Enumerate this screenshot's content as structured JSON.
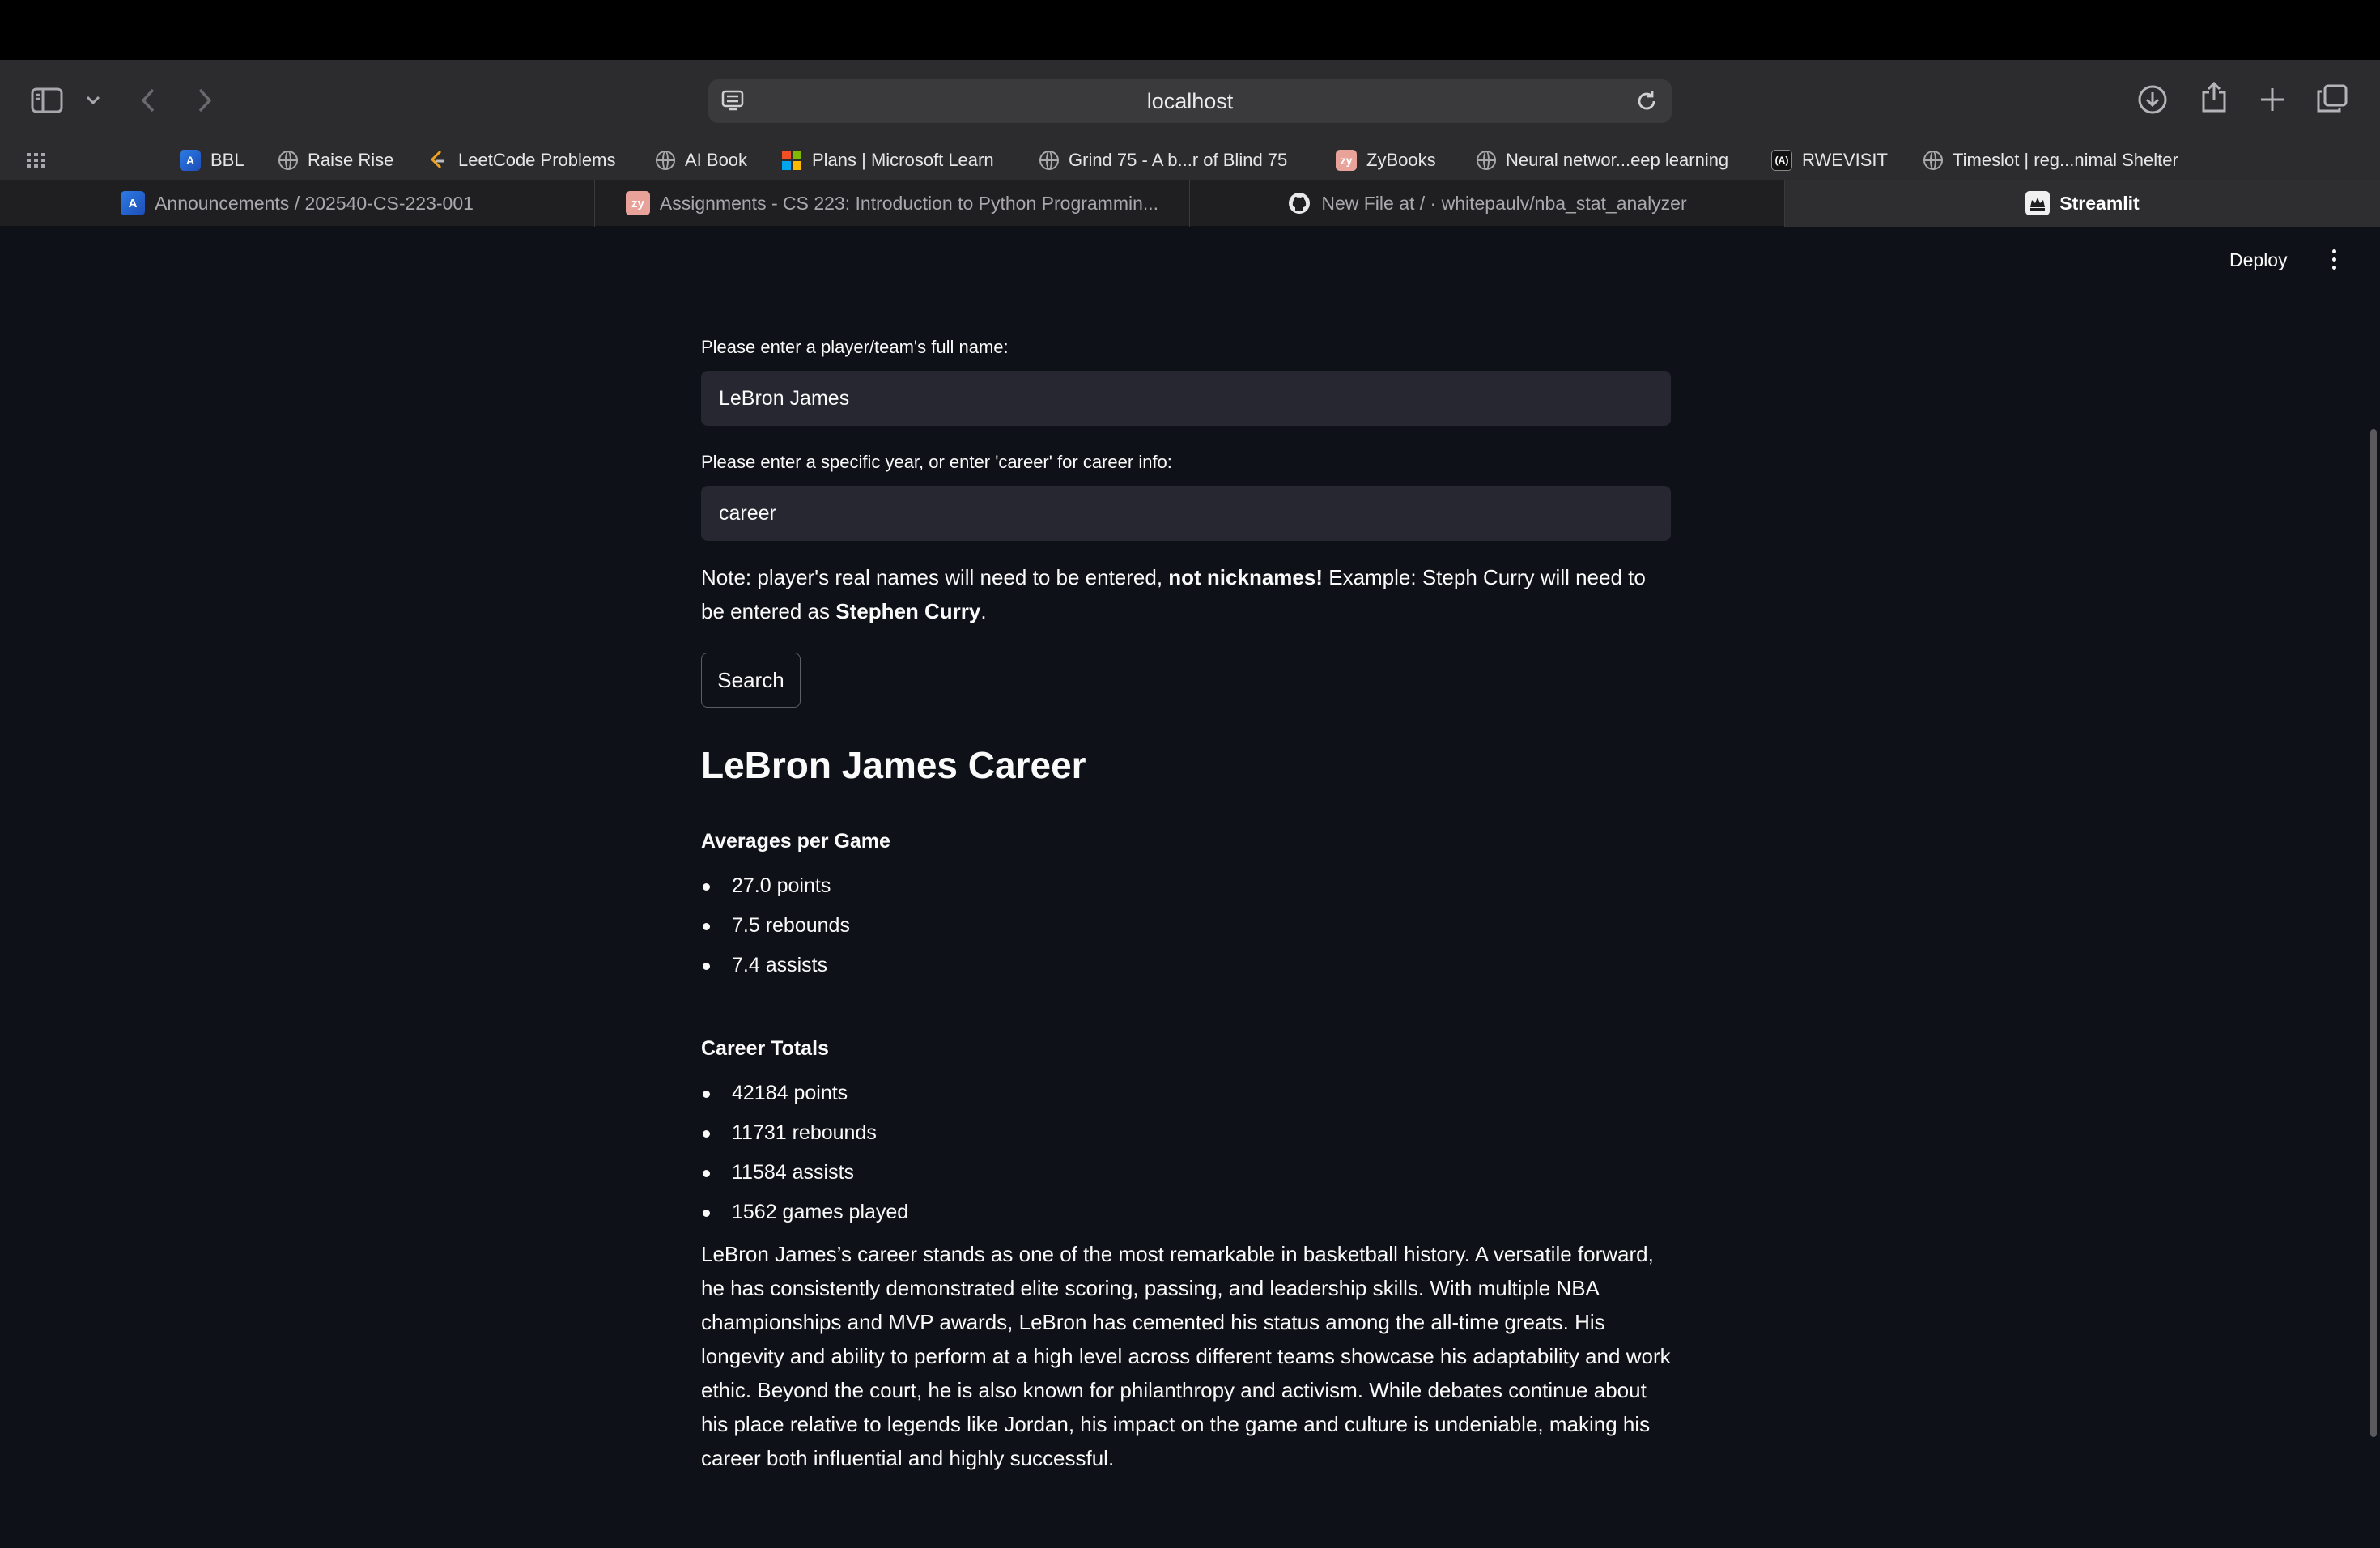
{
  "browser": {
    "url": "localhost",
    "bookmarks": [
      {
        "label": "BBL",
        "icon": "canvas-icon"
      },
      {
        "label": "Raise Rise",
        "icon": "globe-icon"
      },
      {
        "label": "LeetCode Problems",
        "icon": "leetcode-icon"
      },
      {
        "label": "AI Book",
        "icon": "globe-icon"
      },
      {
        "label": "Plans | Microsoft Learn",
        "icon": "microsoft-icon"
      },
      {
        "label": "Grind 75 - A b...r of Blind 75",
        "icon": "globe-icon"
      },
      {
        "label": "ZyBooks",
        "icon": "zybooks-icon"
      },
      {
        "label": "Neural networ...eep learning",
        "icon": "globe-icon"
      },
      {
        "label": "RWEVISIT",
        "icon": "rwevisit-icon"
      },
      {
        "label": "Timeslot | reg...nimal Shelter",
        "icon": "globe-icon"
      }
    ],
    "tabs": [
      {
        "label": "Announcements / 202540-CS-223-001",
        "active": false
      },
      {
        "label": "Assignments - CS 223: Introduction to Python Programmin...",
        "active": false
      },
      {
        "label": "New File at / · whitepaulv/nba_stat_analyzer",
        "active": false
      },
      {
        "label": "Streamlit",
        "active": true
      }
    ]
  },
  "app": {
    "deploy_label": "Deploy",
    "name_label": "Please enter a player/team's full name:",
    "name_value": "LeBron James",
    "year_label": "Please enter a specific year, or enter 'career' for career info:",
    "year_value": "career",
    "note": {
      "part1": "Note: player's real names will need to be entered, ",
      "bold1": "not nicknames!",
      "part2": " Example: Steph Curry will need to be entered as ",
      "bold2": "Stephen Curry",
      "part3": "."
    },
    "search_label": "Search",
    "result_title": "LeBron James Career",
    "averages_heading": "Averages per Game",
    "averages": [
      "27.0 points",
      "7.5 rebounds",
      "7.4 assists"
    ],
    "totals_heading": "Career Totals",
    "totals": [
      "42184 points",
      "11731 rebounds",
      "11584 assists",
      "1562 games played"
    ],
    "summary": "LeBron James’s career stands as one of the most remarkable in basketball history. A versatile forward, he has consistently demonstrated elite scoring, passing, and leadership skills. With multiple NBA championships and MVP awards, LeBron has cemented his status among the all-time greats. His longevity and ability to perform at a high level across different teams showcase his adaptability and work ethic. Beyond the court, he is also known for philanthropy and activism. While debates continue about his place relative to legends like Jordan, his impact on the game and culture is undeniable, making his career both influential and highly successful."
  }
}
